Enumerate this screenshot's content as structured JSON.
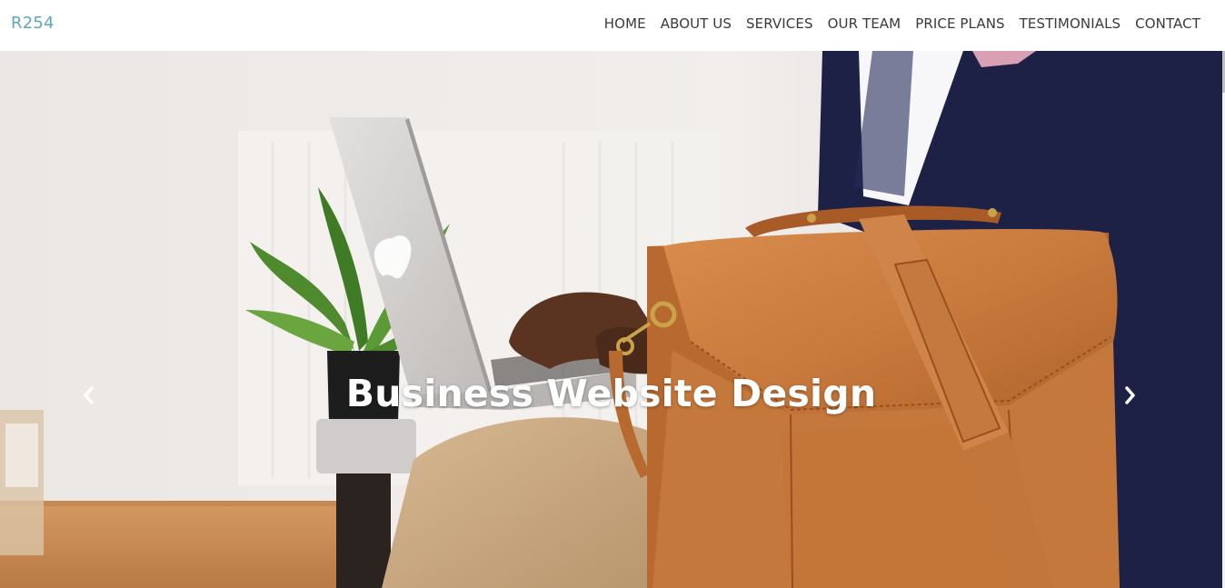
{
  "brand": {
    "name": "R254",
    "color": "#5fa6b8"
  },
  "nav": {
    "items": [
      {
        "label": "HOME"
      },
      {
        "label": "ABOUT US"
      },
      {
        "label": "SERVICES"
      },
      {
        "label": "OUR TEAM"
      },
      {
        "label": "PRICE PLANS"
      },
      {
        "label": "TESTIMONIALS"
      },
      {
        "label": "CONTACT"
      }
    ]
  },
  "carousel": {
    "caption": "Business Website Design",
    "prev_icon": "chevron-left-icon",
    "next_icon": "chevron-right-icon"
  }
}
